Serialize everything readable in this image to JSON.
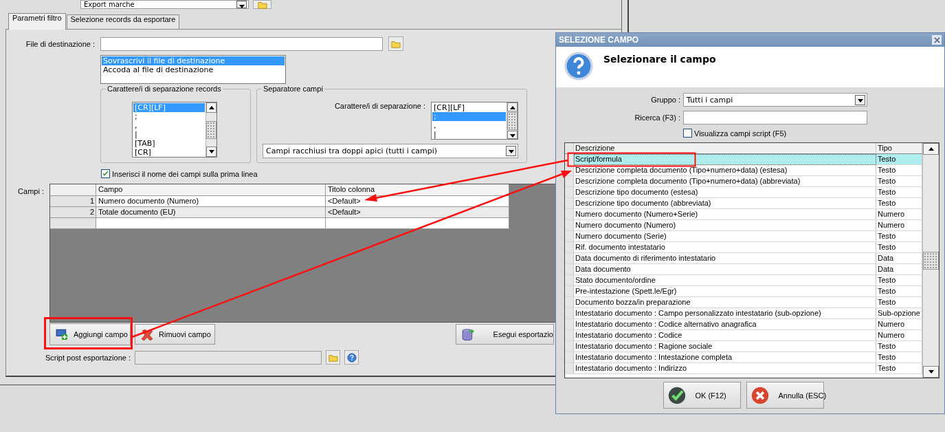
{
  "top_combo": {
    "value": "Export marche"
  },
  "tabs": [
    {
      "label": "Parametri filtro",
      "selected": true
    },
    {
      "label": "Selezione records da esportare",
      "selected": false
    }
  ],
  "destination": {
    "label": "File di destinazione :"
  },
  "write_mode_options": [
    {
      "label": "Sovrascrivi il file di destinazione",
      "selected": true
    },
    {
      "label": "Accoda al file di destinazione",
      "selected": false
    }
  ],
  "record_separator": {
    "title": "Carattere/i di separazione records",
    "options": [
      {
        "label": "[CR][LF]",
        "selected": true
      },
      {
        "label": ";",
        "selected": false
      },
      {
        "label": ",",
        "selected": false
      },
      {
        "label": "|",
        "selected": false
      },
      {
        "label": "[TAB]",
        "selected": false
      },
      {
        "label": "[CR]",
        "selected": false
      }
    ]
  },
  "field_separator": {
    "title": "Separatore campi",
    "label": "Carattere/i di separazione :",
    "options": [
      {
        "label": "[CR][LF]",
        "selected": false
      },
      {
        "label": ";",
        "selected": true
      },
      {
        "label": ",",
        "selected": false
      },
      {
        "label": "|",
        "selected": false
      }
    ],
    "quote_mode": "Campi racchiusi tra doppi apici (tutti i campi)"
  },
  "header_checkbox": {
    "label": "Inserisci il nome dei campi sulla prima linea",
    "checked": true
  },
  "fields_grid": {
    "label": "Campi :",
    "columns": [
      "Campo",
      "Titolo colonna"
    ],
    "rows": [
      {
        "number": "1",
        "field": "Numero documento (Numero)",
        "column_title": "<Default>"
      },
      {
        "number": "2",
        "field": "Totale documento (EU)",
        "column_title": "<Default>"
      }
    ]
  },
  "buttons": [
    {
      "label": "Aggiungi campo",
      "kind": "add"
    },
    {
      "label": "Rimuovi campo",
      "kind": "remove"
    },
    {
      "label": "Esegui esportazio",
      "kind": "export"
    }
  ],
  "post_script": {
    "label": "Script post esportazione :"
  },
  "dialog": {
    "title": "SELEZIONE CAMPO",
    "heading": "Selezionare il campo",
    "group": {
      "label": "Gruppo :",
      "value": "Tutti i campi"
    },
    "search": {
      "label": "Ricerca (F3) :"
    },
    "script_checkbox": {
      "label": "Visualizza campi script (F5)",
      "checked": false
    },
    "columns": [
      "Descrizione",
      "Tipo"
    ],
    "rows": [
      {
        "description": "Script/formula",
        "type": "Testo",
        "selected": true
      },
      {
        "description": "Descrizione completa documento (Tipo+numero+data) (estesa)",
        "type": "Testo",
        "selected": false
      },
      {
        "description": "Descrizione completa documento (Tipo+numero+data) (abbreviata)",
        "type": "Testo",
        "selected": false
      },
      {
        "description": "Descrizione tipo documento (estesa)",
        "type": "Testo",
        "selected": false
      },
      {
        "description": "Descrizione tipo documento (abbreviata)",
        "type": "Testo",
        "selected": false
      },
      {
        "description": "Numero documento (Numero+Serie)",
        "type": "Numero",
        "selected": false
      },
      {
        "description": "Numero documento (Numero)",
        "type": "Numero",
        "selected": false
      },
      {
        "description": "Numero documento (Serie)",
        "type": "Testo",
        "selected": false
      },
      {
        "description": "Rif. documento intestatario",
        "type": "Testo",
        "selected": false
      },
      {
        "description": "Data documento di riferimento intestatario",
        "type": "Data",
        "selected": false
      },
      {
        "description": "Data documento",
        "type": "Data",
        "selected": false
      },
      {
        "description": "Stato documento/ordine",
        "type": "Testo",
        "selected": false
      },
      {
        "description": "Pre-intestazione (Spett.le/Egr)",
        "type": "Testo",
        "selected": false
      },
      {
        "description": "Documento bozza/in preparazione",
        "type": "Testo",
        "selected": false
      },
      {
        "description": "Intestatario documento : Campo personalizzato intestatario (sub-opzione)",
        "type": "Sub-opzione",
        "selected": false
      },
      {
        "description": "Intestatario documento : Codice alternativo anagrafica",
        "type": "Numero",
        "selected": false
      },
      {
        "description": "Intestatario documento : Codice",
        "type": "Numero",
        "selected": false
      },
      {
        "description": "Intestatario documento : Ragione sociale",
        "type": "Testo",
        "selected": false
      },
      {
        "description": "Intestatario documento : Intestazione completa",
        "type": "Testo",
        "selected": false
      },
      {
        "description": "Intestatario documento : Indirizzo",
        "type": "Testo",
        "selected": false
      }
    ],
    "buttons": [
      {
        "label": "OK (F12)",
        "kind": "ok"
      },
      {
        "label": "Annulla (ESC)",
        "kind": "cancel"
      }
    ]
  }
}
